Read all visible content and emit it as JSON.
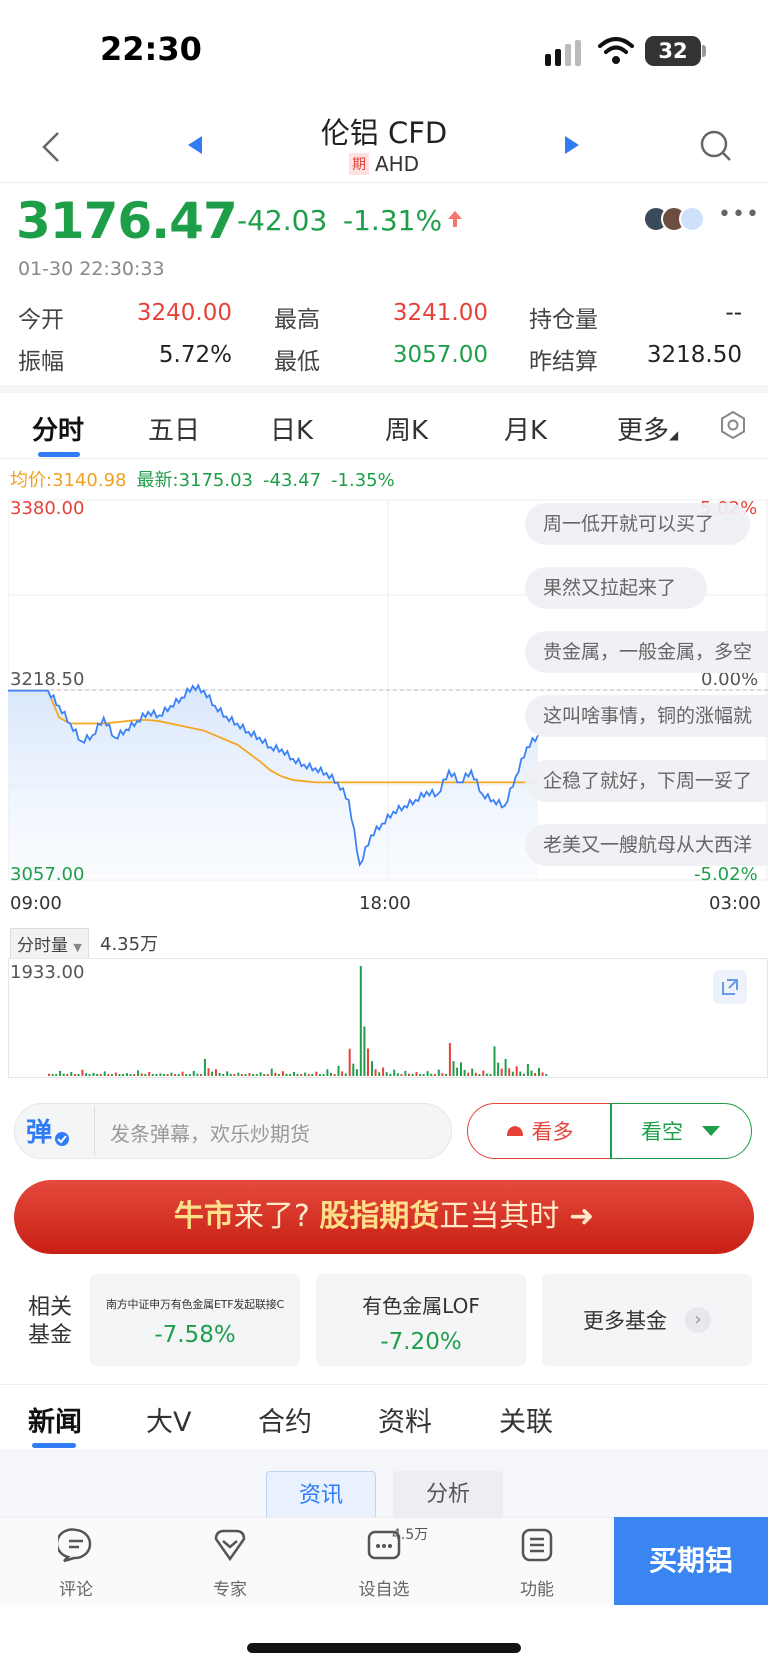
{
  "status_bar": {
    "time": "22:30",
    "battery": "32"
  },
  "header": {
    "title": "伦铝 CFD",
    "tag": "期",
    "code": "AHD"
  },
  "quote": {
    "price": "3176.47",
    "change": "-42.03",
    "change_pct": "-1.31%",
    "timestamp": "01-30 22:30:33",
    "stats": [
      {
        "label": "今开",
        "value": "3240.00",
        "color": "red"
      },
      {
        "label": "最高",
        "value": "3241.00",
        "color": "red"
      },
      {
        "label": "持仓量",
        "value": "--",
        "color": "dark"
      },
      {
        "label": "振幅",
        "value": "5.72%",
        "color": "dark"
      },
      {
        "label": "最低",
        "value": "3057.00",
        "color": "green"
      },
      {
        "label": "昨结算",
        "value": "3218.50",
        "color": "dark"
      }
    ]
  },
  "tabs": [
    "分时",
    "五日",
    "日K",
    "周K",
    "月K",
    "更多"
  ],
  "legend": {
    "avg": "均价:3140.98",
    "latest": "最新:3175.03",
    "chg": "-43.47",
    "pct": "-1.35%"
  },
  "chart_data": {
    "type": "line",
    "ylim": [
      3057.0,
      3380.0
    ],
    "y_labels": {
      "top": "3380.00",
      "mid": "3218.50",
      "bottom": "3057.00"
    },
    "pct_labels": {
      "top": "5.02%",
      "mid": "0.00%",
      "bottom": "-5.02%"
    },
    "x_labels": [
      "09:00",
      "18:00",
      "03:00"
    ],
    "series": [
      {
        "values": [
          3218,
          3205,
          3190,
          3175,
          3180,
          3195,
          3178,
          3185,
          3192,
          3200,
          3197,
          3205,
          3212,
          3222,
          3218,
          3205,
          3196,
          3190,
          3183,
          3178,
          3170,
          3168,
          3160,
          3155,
          3152,
          3148,
          3140,
          3125,
          3070,
          3095,
          3105,
          3115,
          3120,
          3125,
          3132,
          3130,
          3150,
          3140,
          3150,
          3130,
          3125,
          3120,
          3145,
          3170,
          3180
        ]
      },
      {
        "values": [
          3218,
          3195,
          3190,
          3190,
          3190,
          3190,
          3191,
          3192,
          3193,
          3193,
          3192,
          3190,
          3188,
          3186,
          3184,
          3180,
          3176,
          3172,
          3165,
          3158,
          3150,
          3145,
          3142,
          3141,
          3140,
          3140,
          3140,
          3140,
          3140,
          3140,
          3140,
          3140,
          3140,
          3140,
          3140,
          3140,
          3140,
          3140,
          3140,
          3140,
          3140,
          3140,
          3140,
          3140,
          3140
        ]
      }
    ]
  },
  "danmaku": [
    "周一低开就可以买了",
    "果然又拉起来了",
    "贵金属，一般金属，多空",
    "这叫啥事情，铜的涨幅就",
    "企稳了就好，下周一妥了",
    "老美又一艘航母从大西洋"
  ],
  "volume": {
    "dropdown": "分时量",
    "total": "4.35万",
    "max": "1933.00",
    "bars": [
      40,
      90,
      70,
      110,
      55,
      80,
      60,
      50,
      100,
      70,
      45,
      60,
      75,
      90,
      300,
      120,
      80,
      60,
      55,
      65,
      130,
      85,
      70,
      60,
      75,
      120,
      180,
      480,
      1933,
      260,
      150,
      110,
      90,
      70,
      85,
      110,
      580,
      240,
      130,
      95,
      520,
      300,
      170,
      210,
      140
    ]
  },
  "danmu_input": {
    "placeholder": "发条弹幕，欢乐炒期货",
    "long": "看多",
    "short": "看空"
  },
  "banner": {
    "pre": "牛市",
    "mid": "来了?",
    "bold": "股指期货",
    "post": "正当其时"
  },
  "funds": {
    "label": "相关基金",
    "items": [
      {
        "name": "南方中证申万有色金属ETF发起联接C",
        "pct": "-7.58%"
      },
      {
        "name": "有色金属LOF",
        "pct": "-7.20%"
      }
    ],
    "more": "更多基金"
  },
  "news_tabs": [
    "新闻",
    "大V",
    "合约",
    "资料",
    "关联"
  ],
  "sub_tabs": [
    "资讯",
    "分析"
  ],
  "bottom_nav": {
    "items": [
      "评论",
      "专家",
      "设自选",
      "功能"
    ],
    "badge": "4.5万",
    "buy": "买期铝"
  },
  "colors": {
    "red": "#e5433a",
    "green": "#1f9e4a",
    "blue": "#2f7cf6",
    "avg_line": "#f5a623",
    "price_line": "#3b82f6"
  }
}
